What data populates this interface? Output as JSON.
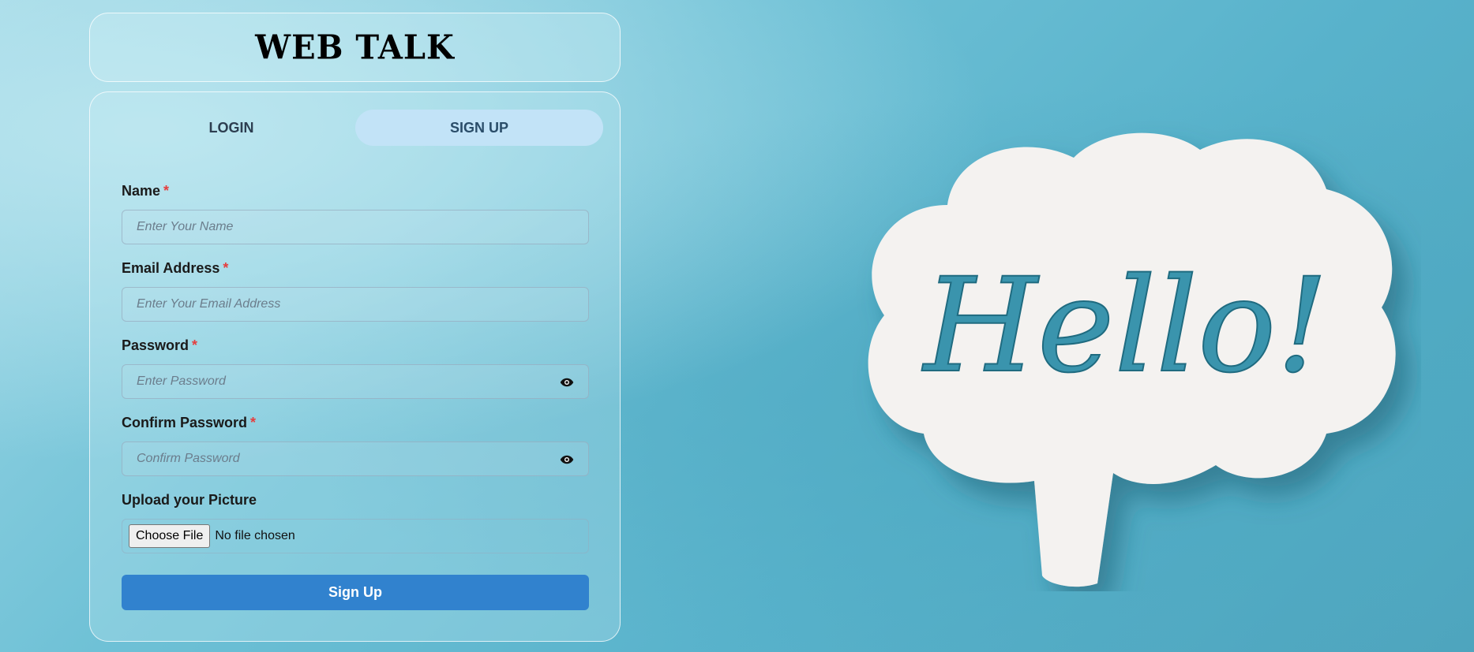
{
  "app": {
    "title": "WEB TALK"
  },
  "tabs": [
    {
      "label": "LOGIN",
      "active": false
    },
    {
      "label": "SIGN UP",
      "active": true
    }
  ],
  "form": {
    "name": {
      "label": "Name",
      "required_mark": "*",
      "placeholder": "Enter Your Name"
    },
    "email": {
      "label": "Email Address",
      "required_mark": "*",
      "placeholder": "Enter Your Email Address"
    },
    "password": {
      "label": "Password",
      "required_mark": "*",
      "placeholder": "Enter Password",
      "toggle_icon": "eye-icon"
    },
    "confirm_password": {
      "label": "Confirm Password",
      "required_mark": "*",
      "placeholder": "Confirm Password",
      "toggle_icon": "eye-icon"
    },
    "picture": {
      "label": "Upload your Picture",
      "button_label": "Choose File",
      "status": "No file chosen"
    },
    "submit_label": "Sign Up"
  },
  "illustration": {
    "text": "Hello!"
  },
  "colors": {
    "accent": "#3182ce",
    "active_tab": "#c2e3f7",
    "required": "#e53e3e",
    "background": "#5fb6cd"
  }
}
